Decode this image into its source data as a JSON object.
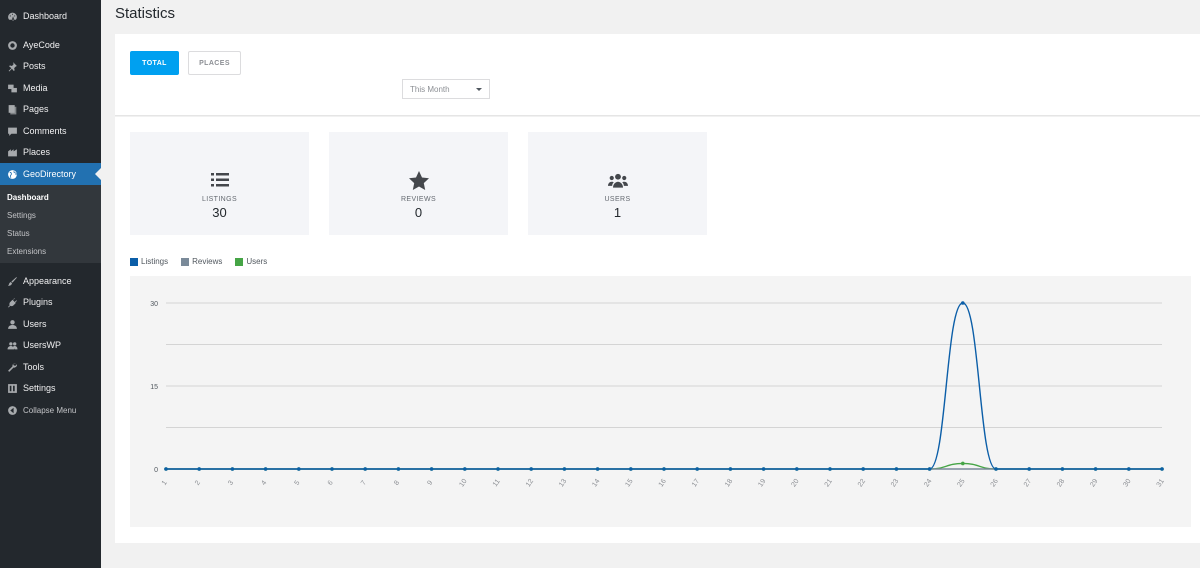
{
  "sidebar": {
    "items": [
      {
        "label": "Dashboard",
        "icon": "dashboard-icon"
      },
      {
        "label": "AyeCode",
        "icon": "ayecode-icon"
      },
      {
        "label": "Posts",
        "icon": "pin-icon"
      },
      {
        "label": "Media",
        "icon": "media-icon"
      },
      {
        "label": "Pages",
        "icon": "pages-icon"
      },
      {
        "label": "Comments",
        "icon": "comments-icon"
      },
      {
        "label": "Places",
        "icon": "places-icon"
      },
      {
        "label": "GeoDirectory",
        "icon": "globe-icon"
      },
      {
        "label": "Appearance",
        "icon": "brush-icon"
      },
      {
        "label": "Plugins",
        "icon": "plugins-icon"
      },
      {
        "label": "Users",
        "icon": "user-icon"
      },
      {
        "label": "UsersWP",
        "icon": "userswp-icon"
      },
      {
        "label": "Tools",
        "icon": "wrench-icon"
      },
      {
        "label": "Settings",
        "icon": "settings-icon"
      }
    ],
    "submenu": [
      "Dashboard",
      "Settings",
      "Status",
      "Extensions"
    ],
    "collapse_label": "Collapse Menu"
  },
  "header": {
    "title": "Statistics"
  },
  "tabs": {
    "total": "TOTAL",
    "places": "PLACES"
  },
  "period_select": {
    "value": "This Month"
  },
  "cards": [
    {
      "label": "LISTINGS",
      "value": "30",
      "icon": "list-icon"
    },
    {
      "label": "REVIEWS",
      "value": "0",
      "icon": "star-icon"
    },
    {
      "label": "USERS",
      "value": "1",
      "icon": "users-icon"
    }
  ],
  "colors": {
    "accent": "#2271b1",
    "tab_active": "#00a0f0",
    "listings": "#0b5ea8",
    "reviews": "#7a8a99",
    "users": "#46a546"
  },
  "chart_data": {
    "type": "line",
    "x": [
      1,
      2,
      3,
      4,
      5,
      6,
      7,
      8,
      9,
      10,
      11,
      12,
      13,
      14,
      15,
      16,
      17,
      18,
      19,
      20,
      21,
      22,
      23,
      24,
      25,
      26,
      27,
      28,
      29,
      30,
      31
    ],
    "series": [
      {
        "name": "Listings",
        "values": [
          0,
          0,
          0,
          0,
          0,
          0,
          0,
          0,
          0,
          0,
          0,
          0,
          0,
          0,
          0,
          0,
          0,
          0,
          0,
          0,
          0,
          0,
          0,
          0,
          30,
          0,
          0,
          0,
          0,
          0,
          0
        ]
      },
      {
        "name": "Reviews",
        "values": [
          0,
          0,
          0,
          0,
          0,
          0,
          0,
          0,
          0,
          0,
          0,
          0,
          0,
          0,
          0,
          0,
          0,
          0,
          0,
          0,
          0,
          0,
          0,
          0,
          0,
          0,
          0,
          0,
          0,
          0,
          0
        ]
      },
      {
        "name": "Users",
        "values": [
          0,
          0,
          0,
          0,
          0,
          0,
          0,
          0,
          0,
          0,
          0,
          0,
          0,
          0,
          0,
          0,
          0,
          0,
          0,
          0,
          0,
          0,
          0,
          0,
          1,
          0,
          0,
          0,
          0,
          0,
          0
        ]
      }
    ],
    "yticks": [
      0,
      15,
      30
    ],
    "ylim": [
      0,
      30
    ],
    "grid": true,
    "legend": "top-left"
  }
}
